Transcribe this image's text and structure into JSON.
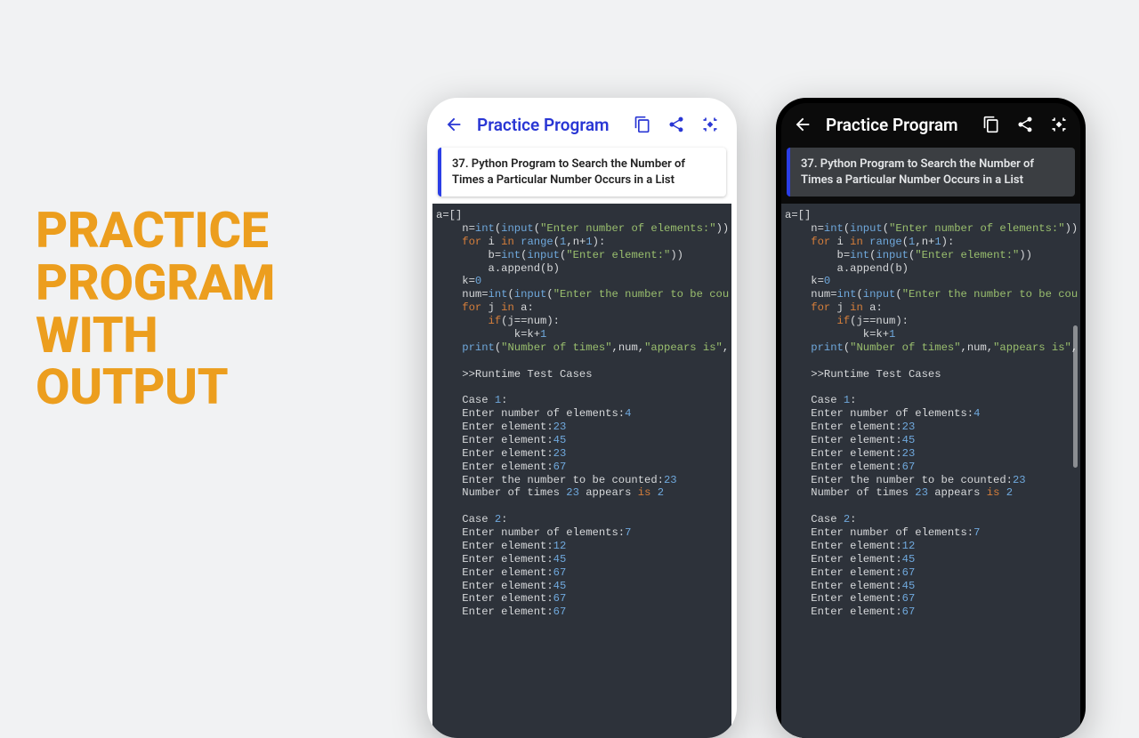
{
  "headline": {
    "line1": "PRACTICE",
    "line2": "PROGRAM",
    "line3": "WITH",
    "line4": "OUTPUT"
  },
  "appbar": {
    "title": "Practice Program"
  },
  "card": {
    "text": "37. Python Program to Search the Number of Times a Particular Number Occurs in a List"
  },
  "code": {
    "l1": "a=[]",
    "l2a": "    n=",
    "l2b": "int",
    "l2c": "(",
    "l2d": "input",
    "l2e": "(",
    "l2f": "\"Enter number of elements:\"",
    "l2g": "))",
    "l3a": "    ",
    "l3b": "for",
    "l3c": " i ",
    "l3d": "in",
    "l3e": " ",
    "l3f": "range",
    "l3g": "(",
    "l3h": "1",
    "l3i": ",n+",
    "l3j": "1",
    "l3k": "):",
    "l4a": "        b=",
    "l4b": "int",
    "l4c": "(",
    "l4d": "input",
    "l4e": "(",
    "l4f": "\"Enter element:\"",
    "l4g": "))",
    "l5": "        a.append(b)",
    "l6a": "    k=",
    "l6b": "0",
    "l7a": "    num=",
    "l7b": "int",
    "l7c": "(",
    "l7d": "input",
    "l7e": "(",
    "l7f": "\"Enter the number to be cou",
    "l8a": "    ",
    "l8b": "for",
    "l8c": " j ",
    "l8d": "in",
    "l8e": " a:",
    "l9a": "        ",
    "l9b": "if",
    "l9c": "(j==num):",
    "l10a": "            k=k+",
    "l10b": "1",
    "l11a": "    ",
    "l11b": "print",
    "l11c": "(",
    "l11d": "\"Number of times\"",
    "l11e": ",num,",
    "l11f": "\"appears is\"",
    "l11g": ",",
    "blank": "",
    "rt": "    >>Runtime Test Cases",
    "c1a": "    Case ",
    "c1b": "1",
    "c1c": ":",
    "e1a": "    Enter number of elements:",
    "e1b": "4",
    "e2a": "    Enter element:",
    "e2b": "23",
    "e3a": "    Enter element:",
    "e3b": "45",
    "e4a": "    Enter element:",
    "e4b": "23",
    "e5a": "    Enter element:",
    "e5b": "67",
    "e6a": "    Enter the number to be counted:",
    "e6b": "23",
    "r1a": "    Number of times ",
    "r1b": "23",
    "r1c": " appears ",
    "r1d": "is",
    "r1e": " ",
    "r1f": "2",
    "c2a": "    Case ",
    "c2b": "2",
    "c2c": ":",
    "f1a": "    Enter number of elements:",
    "f1b": "7",
    "f2a": "    Enter element:",
    "f2b": "12",
    "f3a": "    Enter element:",
    "f3b": "45",
    "f4a": "    Enter element:",
    "f4b": "67",
    "f5a": "    Enter element:",
    "f5b": "45",
    "f6a": "    Enter element:",
    "f6b": "67",
    "f7a": "    Enter element:",
    "f7b": "67"
  }
}
